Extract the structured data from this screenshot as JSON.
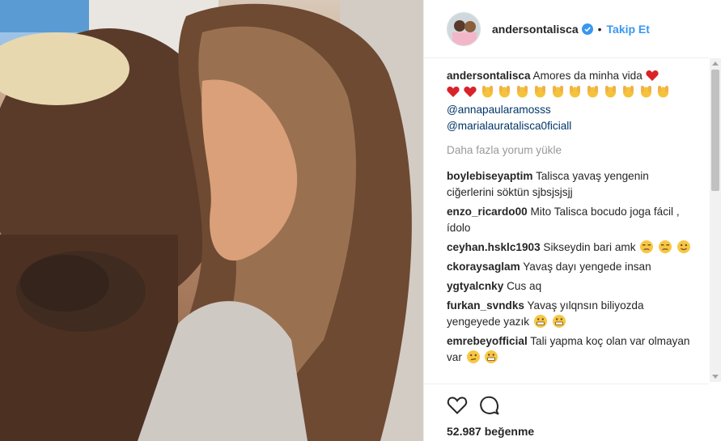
{
  "post": {
    "author": "andersontalisca",
    "separator": "•",
    "follow_label": "Takip Et",
    "caption_text": "Amores da minha vida",
    "caption_mentions": [
      "@annapaularamosss",
      "@marialauratalisca0ficiall"
    ],
    "load_more_label": "Daha fazla yorum yükle",
    "likes_text": "52.987 beğenme"
  },
  "comments": [
    {
      "user": "boylebiseyaptim",
      "text": "Talisca yavaş yengenin ciğerlerini söktün sjbsjsjsjj"
    },
    {
      "user": "enzo_ricardo00",
      "text": "Mito Talisca bocudo joga fácil , ídolo"
    },
    {
      "user": "ceyhan.hsklc1903",
      "text": "Sikseydin bari amk"
    },
    {
      "user": "ckoraysaglam",
      "text": "Yavaş dayı yengede insan"
    },
    {
      "user": "ygtyalcnky",
      "text": "Cus aq"
    },
    {
      "user": "furkan_svndks",
      "text": "Yavaş yılqnsın biliyozda yengeyede yazık"
    },
    {
      "user": "emrebeyofficial",
      "text": "Tali yapma koç olan var olmayan var"
    }
  ],
  "icons": {
    "verified": "verified-badge-icon",
    "like": "heart-outline-icon",
    "comment": "comment-bubble-icon"
  },
  "colors": {
    "link_blue": "#3897f0",
    "mention_navy": "#003569",
    "muted_gray": "#999999",
    "heart_red": "#ed4956"
  }
}
